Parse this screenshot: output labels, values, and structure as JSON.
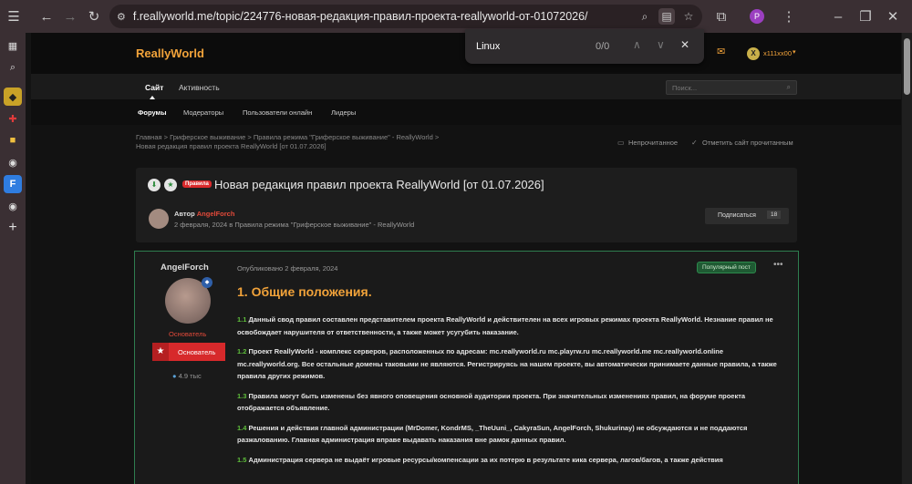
{
  "browser": {
    "url": "f.reallyworld.me/topic/224776-новая-редакция-правил-проекта-reallyworld-от-01072026/",
    "profile_initial": "P"
  },
  "find_bar": {
    "query": "Linux",
    "count": "0/0"
  },
  "site": {
    "logo": "ReallyWorld",
    "username": "x111xx00",
    "user_initial": "X"
  },
  "nav": {
    "primary": [
      "Сайт",
      "Активность"
    ],
    "search_placeholder": "Поиск...",
    "secondary": [
      "Форумы",
      "Модераторы",
      "Пользователи онлайн",
      "Лидеры"
    ]
  },
  "breadcrumb": {
    "line1": "Главная  >  Гриферское выживание  >  Правила режима \"Гриферское выживание\" - ReallyWorld  >",
    "line2": "Новая редакция правил проекта ReallyWorld [от 01.07.2026]"
  },
  "page_actions": {
    "unread": "Непрочитанное",
    "mark_read": "Отметить сайт прочитанным"
  },
  "topic": {
    "badge": "Правила",
    "title": "Новая редакция правил проекта ReallyWorld [от 01.07.2026]",
    "author_label": "Автор",
    "author": "AngelForch",
    "meta": "2 февраля, 2024 в Правила режима \"Гриферское выживание\" - ReallyWorld",
    "subscribe": "Подписаться",
    "subscribe_count": "18"
  },
  "post": {
    "author": "AngelForch",
    "role": "Основатель",
    "group_button": "Основатель",
    "reputation": "4.9 тыс",
    "published": "Опубликовано 2 февраля, 2024",
    "popular": "Популярный пост",
    "heading": "1. Общие положения.",
    "paragraphs": [
      {
        "num": "1.1",
        "text": " Данный свод правил составлен представителем проекта ReallyWorld и действителен на всех игровых режимах проекта ReallyWorld. Незнание правил не освобождает нарушителя от ответственности, а также может усугубить наказание."
      },
      {
        "num": "1.2",
        "text": " Проект ReallyWorld - комплекс серверов, расположенных по адресам: mc.reallyworld.ru mc.playrw.ru mc.reallyworld.me mc.reallyworld.online mc.reallyworld.org. Все остальные домены таковыми не являются. Регистрируясь на нашем проекте, вы автоматически принимаете данные правила, а также правила других режимов."
      },
      {
        "num": "1.3",
        "text": " Правила могут быть изменены без явного оповещения основной аудитории проекта. При значительных изменениях правил, на форуме проекта отображается объявление."
      },
      {
        "num": "1.4",
        "text": " Решения и действия главной администрации (MrDomer, KondrMS, _TheUuni_, CakyraSun, AngelForch, Shukurinay) не обсуждаются и не поддаются разжалованию. Главная администрация вправе выдавать наказания вне рамок данных правил."
      },
      {
        "num": "1.5",
        "text": " Администрация сервера не выдаёт игровые ресурсы/компенсации за их потерю в результате кика сервера, лагов/багов, а также действия"
      }
    ]
  }
}
